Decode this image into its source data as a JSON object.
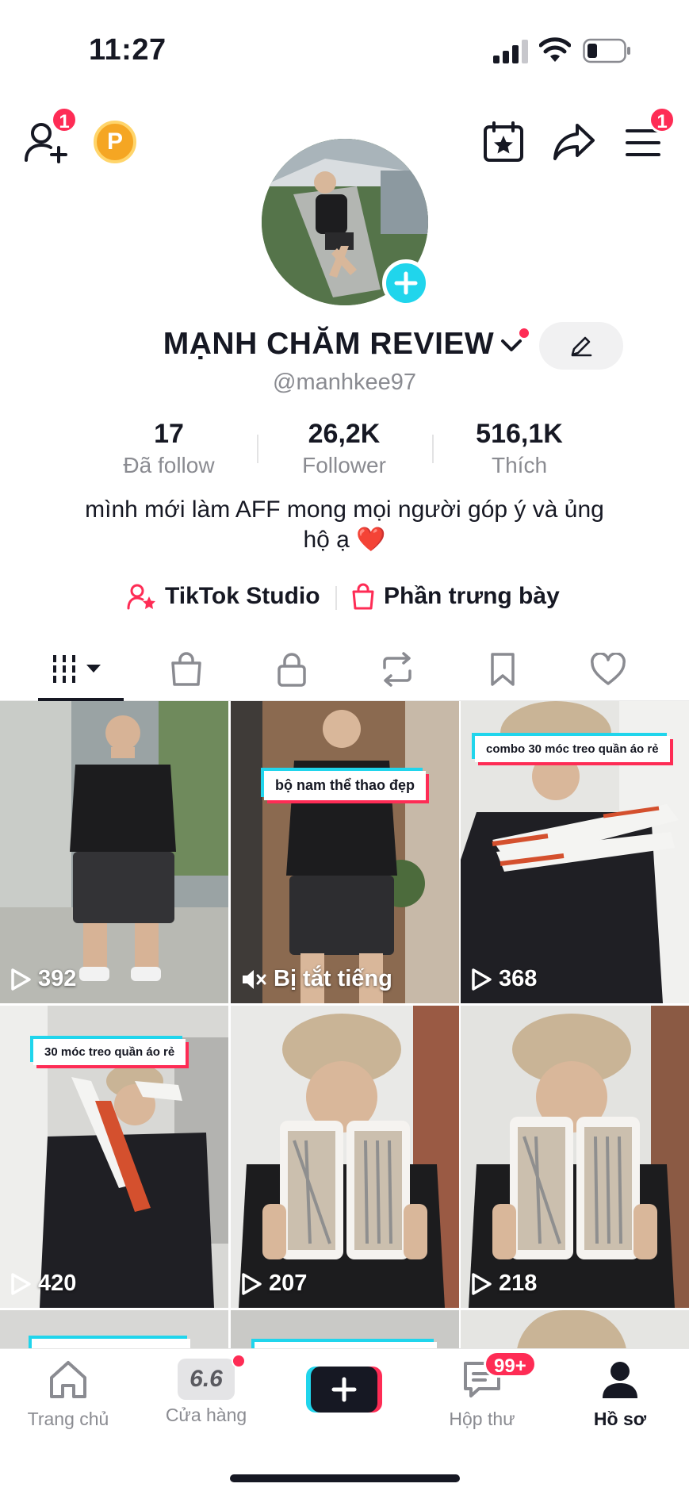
{
  "status_bar": {
    "time": "11:27"
  },
  "top_bar": {
    "add_friend_badge": "1",
    "points_label": "P",
    "menu_badge": "1"
  },
  "profile": {
    "display_name": "MẠNH CHĂM REVIEW",
    "username": "@manhkee97",
    "stats": [
      {
        "value": "17",
        "label": "Đã follow"
      },
      {
        "value": "26,2K",
        "label": "Follower"
      },
      {
        "value": "516,1K",
        "label": "Thích"
      }
    ],
    "bio_line1": "mình mới làm AFF mong mọi người góp ý và ủng",
    "bio_line2": "hộ ạ ❤️",
    "links": {
      "studio": "TikTok Studio",
      "showcase": "Phần trưng bày"
    }
  },
  "videos": [
    {
      "views": "392",
      "label": ""
    },
    {
      "views": "Bị tắt tiếng",
      "label": "bộ nam thể thao đẹp",
      "muted": true
    },
    {
      "views": "368",
      "label": "combo 30 móc treo quần áo rẻ"
    },
    {
      "views": "420",
      "label": "30 móc treo quần áo rẻ"
    },
    {
      "views": "207",
      "label": ""
    },
    {
      "views": "218",
      "label": ""
    }
  ],
  "bottom_nav": {
    "home": "Trang chủ",
    "shop": "Cửa hàng",
    "shop_icon_text": "6.6",
    "inbox": "Hộp thư",
    "inbox_badge": "99+",
    "profile": "Hồ sơ"
  },
  "colors": {
    "accent_red": "#fe2c55",
    "accent_cyan": "#20d5ec",
    "points_orange": "#f5a623"
  }
}
